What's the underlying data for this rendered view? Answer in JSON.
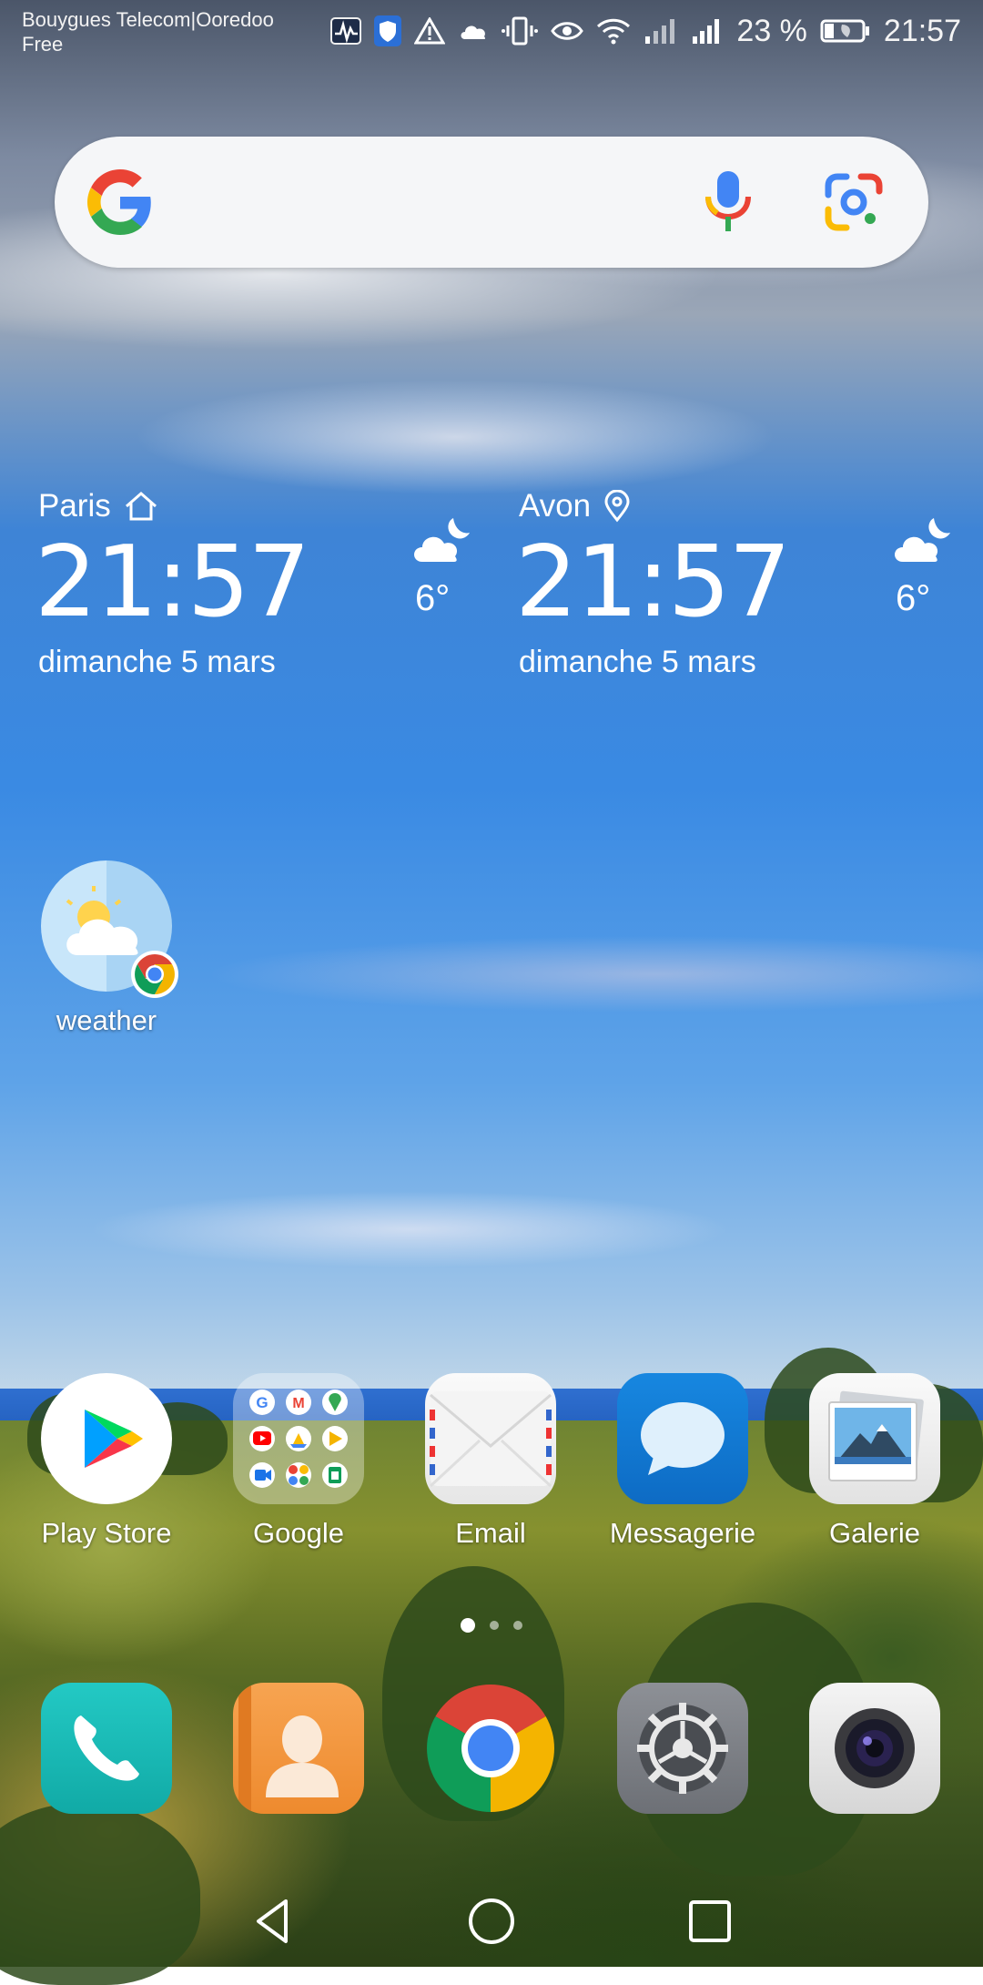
{
  "status_bar": {
    "carrier_line1": "Bouygues Telecom|Ooredoo",
    "carrier_line2": "Free",
    "battery": "23 %",
    "time": "21:57"
  },
  "search": {
    "mic_icon": "microphone-icon",
    "lens_icon": "google-lens-icon"
  },
  "clocks": [
    {
      "city": "Paris",
      "city_icon": "home-icon",
      "time": "21:57",
      "date": "dimanche 5 mars",
      "weather_icon": "partly-cloudy-night-icon",
      "temperature": "6°"
    },
    {
      "city": "Avon",
      "city_icon": "location-pin-icon",
      "time": "21:57",
      "date": "dimanche 5 mars",
      "weather_icon": "partly-cloudy-night-icon",
      "temperature": "6°"
    }
  ],
  "shortcut": {
    "label": "weather"
  },
  "apps_row": [
    {
      "label": "Play Store"
    },
    {
      "label": "Google"
    },
    {
      "label": "Email"
    },
    {
      "label": "Messagerie"
    },
    {
      "label": "Galerie"
    }
  ],
  "dock": [
    {
      "name": "Phone"
    },
    {
      "name": "Contacts"
    },
    {
      "name": "Chrome"
    },
    {
      "name": "Settings"
    },
    {
      "name": "Camera"
    }
  ],
  "page_indicator": {
    "pages": 3,
    "current": 1
  },
  "colors": {
    "sky": "#3a8ae3",
    "accent_blue": "#1a73e8"
  }
}
